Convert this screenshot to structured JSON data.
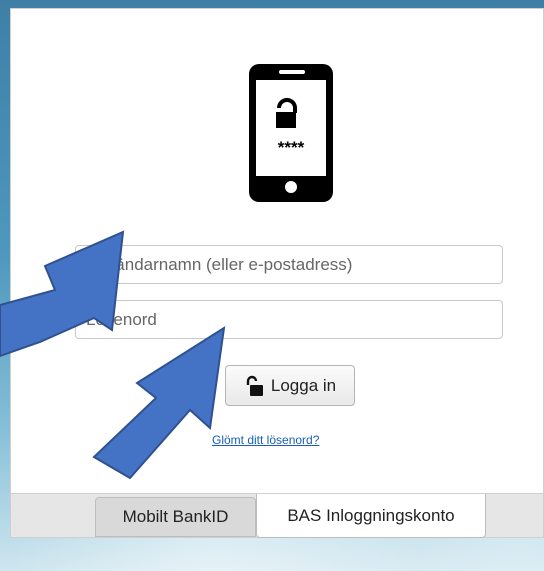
{
  "login": {
    "username_placeholder": "Användarnamn (eller e-postadress)",
    "password_placeholder": "Lösenord",
    "login_button_label": "Logga in",
    "forgot_password_link": "Glömt ditt lösenord?"
  },
  "phone_icon": {
    "pin_text": "****",
    "icon": "phone-unlock-icon"
  },
  "tabs": [
    {
      "label": "Mobilt BankID",
      "active": false
    },
    {
      "label": "BAS Inloggningskonto",
      "active": true
    }
  ],
  "annotation": {
    "type": "arrow",
    "color": "#4472c4",
    "outline_color": "#2f528f"
  },
  "colors": {
    "link": "#1a5fb4",
    "card_background": "#ffffff",
    "tab_bar_background": "#e6e6e6"
  }
}
